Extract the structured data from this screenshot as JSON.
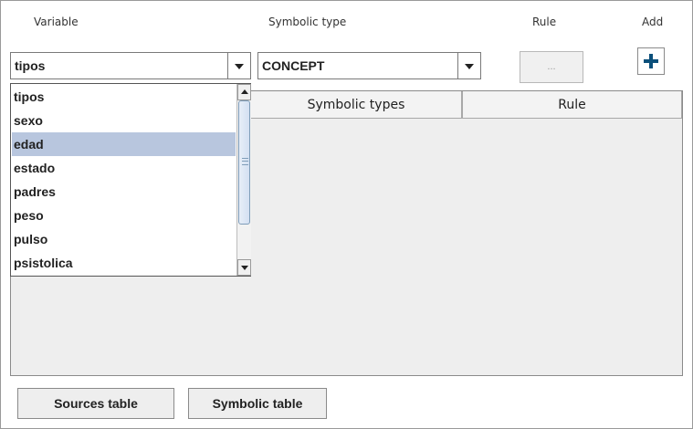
{
  "headers": {
    "variable": "Variable",
    "symbolic_type": "Symbolic type",
    "rule": "Rule",
    "add": "Add"
  },
  "variable_combo": {
    "selected": "tipos",
    "options": [
      "tipos",
      "sexo",
      "edad",
      "estado",
      "padres",
      "peso",
      "pulso",
      "psistolica"
    ],
    "highlighted": "edad"
  },
  "symbolic_type_combo": {
    "selected": "CONCEPT"
  },
  "rule_button": {
    "label": "..."
  },
  "add_button": {
    "icon": "plus-icon",
    "color": "#0b4f7a"
  },
  "table": {
    "columns": [
      "Symbolic types",
      "Rule"
    ]
  },
  "bottom_buttons": {
    "sources": "Sources table",
    "symbolic": "Symbolic table"
  },
  "colors": {
    "highlight": "#b8c6de",
    "panel_bg": "#eeeeee"
  }
}
